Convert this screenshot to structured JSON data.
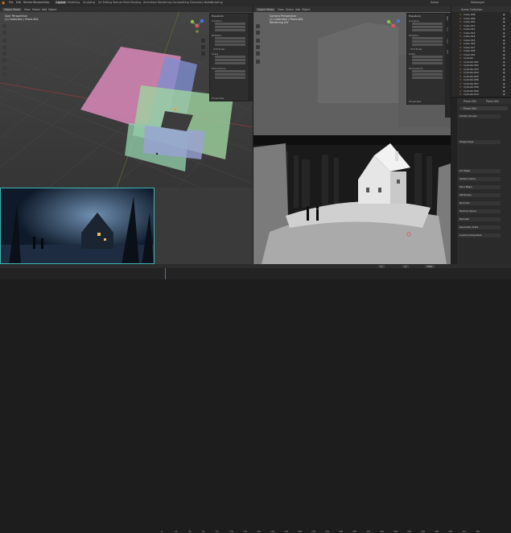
{
  "menubar": {
    "items": [
      "File",
      "Edit",
      "Render",
      "Window",
      "Help"
    ],
    "workspaces": [
      "Layout",
      "Modeling",
      "Sculpting",
      "UV Editing",
      "Texture Paint",
      "Shading",
      "Animation",
      "Rendering",
      "Compositing",
      "Geometry Nodes",
      "Scripting"
    ],
    "active_workspace": "Layout",
    "scene_label": "Scene",
    "layer_label": "ViewLayer"
  },
  "left_viewport": {
    "mode": "Object Mode",
    "menus": [
      "View",
      "Select",
      "Add",
      "Object"
    ],
    "overlay_title": "User Perspective",
    "overlay_subtitle": "(1) Collection | Plane.004",
    "npanel": {
      "header": "Transform",
      "sections": [
        "Location",
        "Rotation",
        "XYZ Euler",
        "Scale",
        "Dimensions"
      ],
      "footer": "Properties"
    }
  },
  "right_viewport": {
    "mode": "Object Mode",
    "menus": [
      "View",
      "Select",
      "Add",
      "Object"
    ],
    "overlay_title": "Camera Perspective",
    "overlay_subtitle": "(1) Collection | Plane.004",
    "overlay_line3": "Rendering 0%",
    "npanel": {
      "header": "Transform",
      "sections": [
        "Location",
        "Rotation",
        "XYZ Euler",
        "Scale",
        "Dimensions"
      ],
      "footer": "Properties"
    },
    "side_tabs": [
      "Item",
      "Tool",
      "View",
      "Edit"
    ]
  },
  "outliner": {
    "header": "Scene Collection",
    "rows": [
      "Cube.008",
      "Cube.009",
      "Cube.010",
      "Cube.011",
      "Cube.012",
      "Cube.013",
      "Cube.014",
      "Cube.015",
      "Cube.016",
      "Cube.017",
      "Cube.018",
      "Cube.019",
      "Cylinder",
      "Cylinder.001",
      "Cylinder.002",
      "Cylinder.003",
      "Cylinder.004",
      "Cylinder.005",
      "Cylinder.006",
      "Cylinder.007",
      "Cylinder.008",
      "Cylinder.009",
      "Cylinder.010"
    ]
  },
  "properties": {
    "object_name": "Plane.004",
    "object_name2": "Plane.004",
    "sections": [
      "Vertex Groups",
      "Shape Keys",
      "UV Maps",
      "Vertex Colors",
      "Face Maps",
      "Attributes",
      "Normals",
      "Texture Space",
      "Remesh",
      "Geometry Data",
      "Custom Properties"
    ]
  },
  "reference_image": {
    "label": "reference"
  },
  "timeline": {
    "frames": [
      "0",
      "20",
      "40",
      "60",
      "80",
      "100",
      "120",
      "140",
      "160",
      "180",
      "200",
      "220",
      "240",
      "260",
      "280",
      "300",
      "320",
      "340",
      "360",
      "380",
      "400",
      "420",
      "440",
      "460"
    ],
    "current_frame": "1",
    "start": "1",
    "end": "250"
  },
  "colors": {
    "accent": "#4772b3",
    "header": "#303030",
    "panel": "#2e2e2e",
    "viewport_bg": "#3a3a3a"
  }
}
